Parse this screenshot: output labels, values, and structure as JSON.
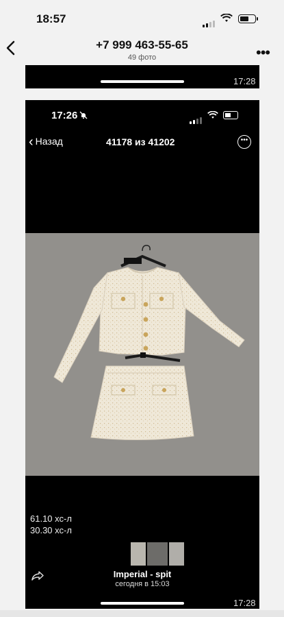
{
  "status_bar": {
    "time": "18:57"
  },
  "header": {
    "contact": "+7 999 463-55-65",
    "photo_count": "49 фото"
  },
  "prev_card": {
    "timestamp": "17:28"
  },
  "inner_screen": {
    "time": "17:26",
    "back_label": "Назад",
    "title": "41178 из 41202"
  },
  "caption": {
    "line1": "61.10 хс-л",
    "line2": "30.30 хс-л"
  },
  "album": {
    "name": "Imperial - spit",
    "date": "сегодня в 15:03"
  },
  "card": {
    "timestamp": "17:28"
  },
  "colors": {
    "card_bg": "#000000",
    "page_bg": "#f2f2f2",
    "tweed": "#efe7d6"
  }
}
